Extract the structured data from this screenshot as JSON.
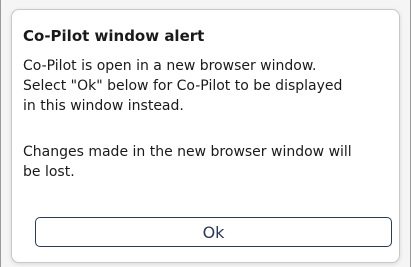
{
  "dialog": {
    "title": "Co-Pilot window alert",
    "message_lines": [
      "Co-Pilot is open in a new browser window.",
      "Select \"Ok\" below for Co-Pilot to be displayed",
      "in this window instead."
    ],
    "warning_lines": [
      "Changes made in the new browser window will",
      "be lost."
    ],
    "ok_label": "Ok"
  },
  "colors": {
    "button_border": "#2b3a55",
    "text": "#1a1a1a"
  }
}
